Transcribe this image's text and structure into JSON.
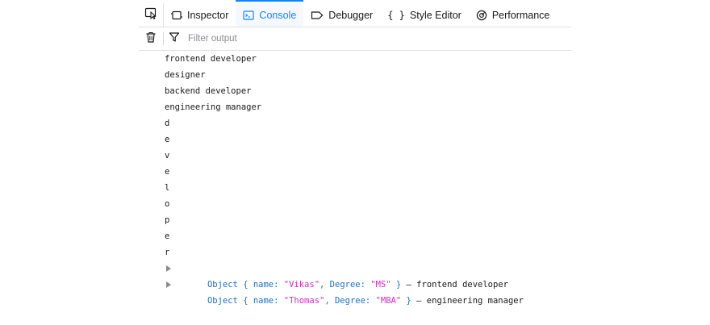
{
  "toolbar": {
    "tabs": [
      {
        "label": "Inspector",
        "icon": "inspector-icon"
      },
      {
        "label": "Console",
        "icon": "console-icon",
        "selected": true
      },
      {
        "label": "Debugger",
        "icon": "debugger-icon"
      },
      {
        "label": "Style Editor",
        "icon": "style-editor-icon"
      },
      {
        "label": "Performance",
        "icon": "performance-icon"
      }
    ],
    "picker_icon": "element-picker-icon"
  },
  "filter": {
    "placeholder": "Filter output",
    "clear_icon": "trash-icon",
    "filter_icon": "funnel-icon"
  },
  "console": {
    "lines": [
      "frontend developer",
      "designer",
      "backend developer",
      "engineering manager",
      "d",
      "e",
      "v",
      "e",
      "l",
      "o",
      "p",
      "e",
      "r"
    ],
    "objects": [
      {
        "prefix": "Object { name: ",
        "name": "\"Vikas\"",
        "mid": ", Degree: ",
        "degree": "\"MS\"",
        "suffix": " }",
        "dash": " – ",
        "text": "frontend developer"
      },
      {
        "prefix": "Object { name: ",
        "name": "\"Thomas\"",
        "mid": ", Degree: ",
        "degree": "\"MBA\"",
        "suffix": " }",
        "dash": " – ",
        "text": "engineering manager"
      }
    ]
  },
  "colors": {
    "accent": "#0a84ff",
    "object_blue": "#1e6fcc",
    "string_magenta": "#d62ec4"
  }
}
